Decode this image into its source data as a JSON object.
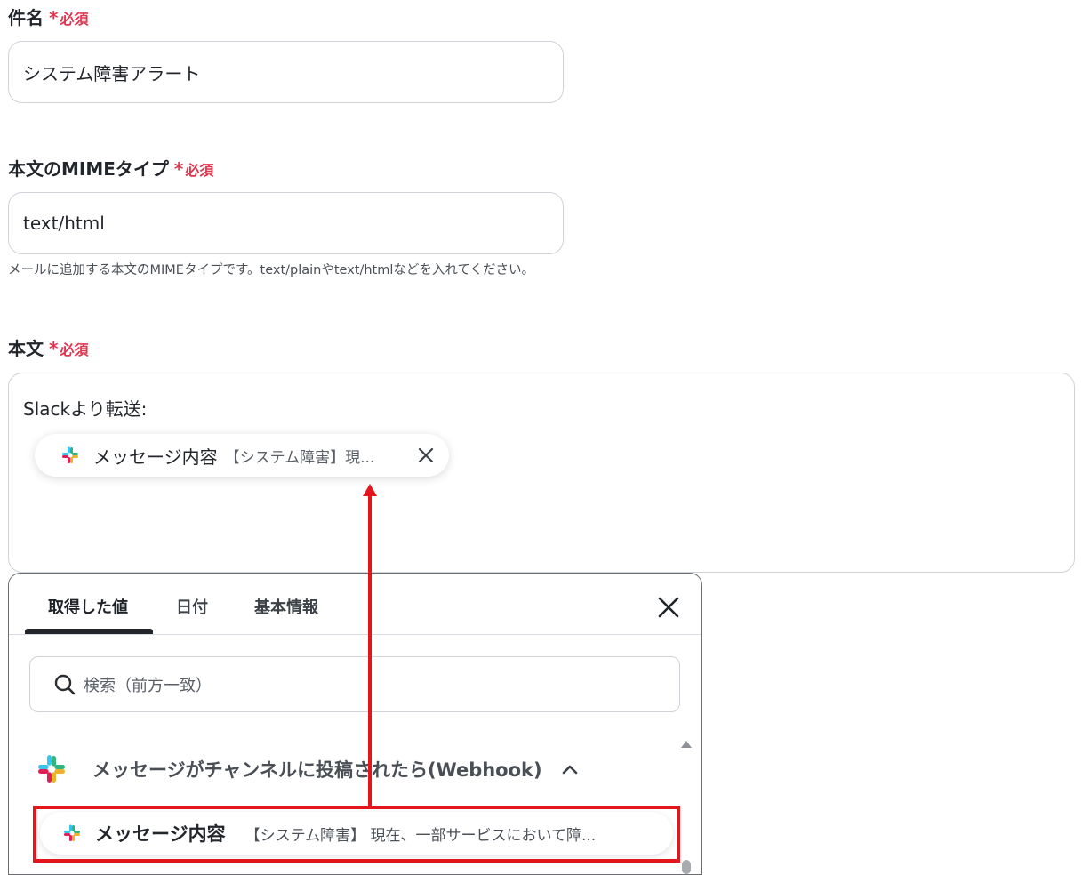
{
  "subject": {
    "label": "件名",
    "required_mark": "*",
    "required_text": "必須",
    "value": "システム障害アラート"
  },
  "mime": {
    "label": "本文のMIMEタイプ",
    "required_mark": "*",
    "required_text": "必須",
    "value": "text/html",
    "help": "メールに追加する本文のMIMEタイプです。text/plainやtext/htmlなどを入れてください。"
  },
  "body": {
    "label": "本文",
    "required_mark": "*",
    "required_text": "必須",
    "prefix": "Slackより転送:",
    "chip": {
      "icon": "slack-icon",
      "name": "メッセージ内容",
      "value": "【システム障害】現..."
    }
  },
  "picker": {
    "tabs": [
      {
        "label": "取得した値",
        "active": true
      },
      {
        "label": "日付",
        "active": false
      },
      {
        "label": "基本情報",
        "active": false
      }
    ],
    "search_placeholder": "検索（前方一致）",
    "group": {
      "icon": "slack-icon",
      "title": "メッセージがチャンネルに投稿されたら(Webhook)",
      "expanded": true
    },
    "item": {
      "icon": "slack-icon",
      "name": "メッセージ内容",
      "value": "【システム障害】 現在、一部サービスにおいて障..."
    }
  },
  "colors": {
    "required": "#e0354f",
    "highlight": "#e3161b",
    "slack_blue": "#36c5f0",
    "slack_green": "#2eb67d",
    "slack_red": "#e01e5a",
    "slack_yellow": "#ecb22e"
  }
}
